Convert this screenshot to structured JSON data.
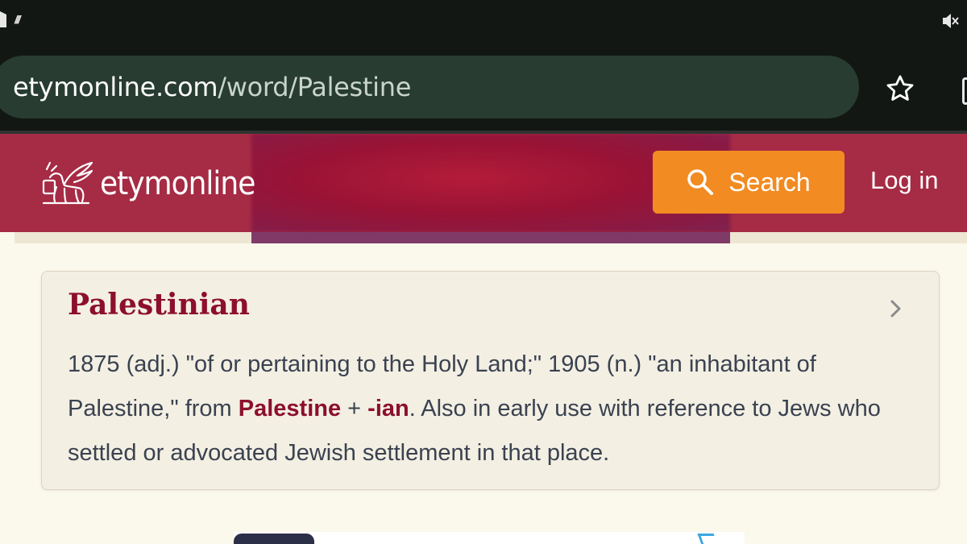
{
  "browser": {
    "url_domain": "etymonline.com",
    "url_path": "/word/Palestine"
  },
  "header": {
    "logo_text": "etymonline",
    "search_label": "Search",
    "login_label": "Log in"
  },
  "entry": {
    "title": "Palestinian",
    "body_part1": "1875 (adj.) \"of or pertaining to the Holy Land;\" 1905 (n.) \"an inhabitant of Palestine,\" from ",
    "xref1": "Palestine",
    "body_part2": " + ",
    "xref2": "-ian",
    "body_part3": ". Also in early use with reference to Jews who settled or advocated Jewish settlement in that place."
  },
  "colors": {
    "header_bg": "#a62b45",
    "search_button": "#f28b22",
    "title_color": "#8c0f2d",
    "page_bg": "#fbf8ec"
  },
  "icons": [
    "mute-icon",
    "star-icon",
    "search-icon",
    "chevron-right-icon",
    "winged-lion-logo-icon"
  ]
}
